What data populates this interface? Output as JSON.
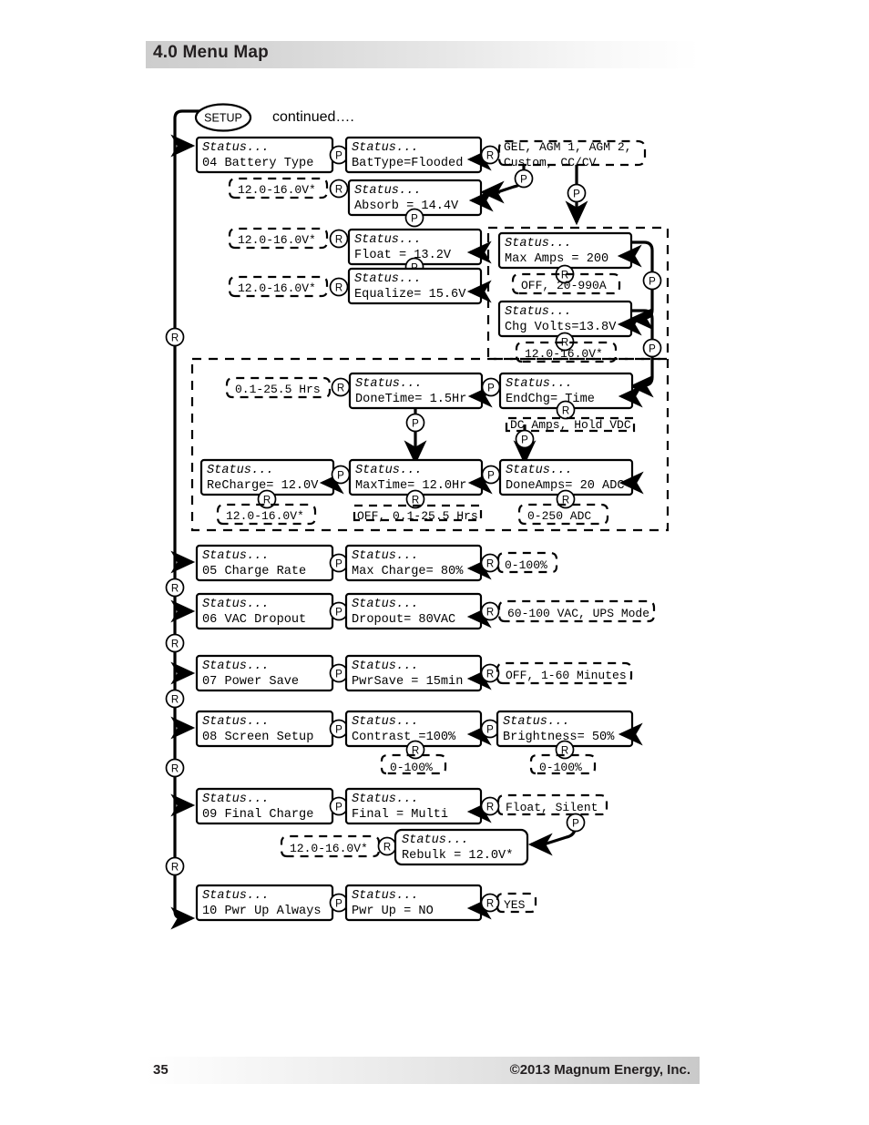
{
  "header": {
    "title": "4.0 Menu Map"
  },
  "footer": {
    "page_number": "35",
    "copyright": "©2013 Magnum Energy, Inc."
  },
  "diagram": {
    "entry_node": "SETUP",
    "continued_label": "continued….",
    "status_label": "Status...",
    "button_press": "P",
    "button_return": "R",
    "menus": [
      {
        "id": "04",
        "title_line": "04 Battery Type",
        "value_line": "BatType=Flooded",
        "options": "GEL, AGM 1, AGM 2, Custom, CC/CV",
        "options_line1": "GEL, AGM 1, AGM 2,",
        "options_line2": "Custom, CC/CV"
      },
      {
        "id": "05",
        "title_line": "05 Charge Rate",
        "value_line": "Max Charge= 80%",
        "options": "0-100%"
      },
      {
        "id": "06",
        "title_line": "06 VAC Dropout",
        "value_line": "Dropout=   80VAC",
        "options": "60-100 VAC, UPS Mode"
      },
      {
        "id": "07",
        "title_line": "07 Power Save",
        "value_line": "PwrSave = 15min",
        "options": "OFF, 1-60 Minutes"
      },
      {
        "id": "08",
        "title_line": "08 Screen Setup",
        "value_line": "Contrast  =100%",
        "options": "0-100%"
      },
      {
        "id": "09",
        "title_line": "09 Final Charge",
        "value_line": "Final =   Multi",
        "options": "Float, Silent"
      },
      {
        "id": "10",
        "title_line": "10 Pwr Up Always",
        "value_line": "Pwr Up =     NO",
        "options": "YES"
      }
    ],
    "battery_sub_items": [
      {
        "value_line": "Absorb  =  14.4V",
        "options": "12.0-16.0V*"
      },
      {
        "value_line": "Float   =  13.2V",
        "options": "12.0-16.0V*"
      },
      {
        "value_line": "Equalize= 15.6V",
        "options": "12.0-16.0V*"
      }
    ],
    "custom_group": [
      {
        "value_line": "Max Amps =  200",
        "options": "OFF, 20-990A"
      },
      {
        "value_line": "Chg Volts=13.8V",
        "options": "12.0-16.0V*"
      },
      {
        "value_line": "EndChg=      Time",
        "options": "DC Amps, Hold VDC",
        "options_underlined": "DC Amps"
      },
      {
        "value_line": "DoneTime= 1.5Hr",
        "options": "0.1-25.5 Hrs"
      },
      {
        "value_line": "DoneAmps= 20 ADC",
        "options": "0-250 ADC"
      },
      {
        "value_line": "MaxTime= 12.0Hr",
        "options": "OFF, 0.1-25.5 Hrs"
      },
      {
        "value_line": "ReCharge=   12.0V",
        "options": "12.0-16.0V*"
      }
    ],
    "screen_sub_items": [
      {
        "value_line": "Brightness= 50%",
        "options": "0-100%"
      }
    ],
    "final_sub_items": [
      {
        "value_line": "Rebulk =  12.0V*",
        "options": "12.0-16.0V*"
      }
    ]
  }
}
